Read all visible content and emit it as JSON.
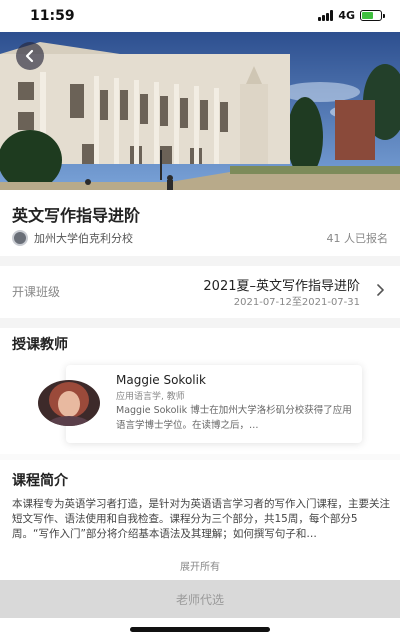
{
  "status_bar": {
    "time": "11:59",
    "network": "4G",
    "battery_level": 0.6,
    "signal_icon": "signal-bars-icon",
    "battery_icon": "battery-icon"
  },
  "hero": {
    "back_icon": "chevron-left-icon"
  },
  "course": {
    "title": "英文写作指导进阶",
    "school": "加州大学伯克利分校",
    "enrolled": "41 人已报名"
  },
  "class_info": {
    "label": "开课班级",
    "name": "2021夏–英文写作指导进阶",
    "dates": "2021-07-12至2021-07-31",
    "arrow_icon": "chevron-right-icon"
  },
  "teacher_section": {
    "title": "授课教师",
    "name": "Maggie Sokolik",
    "role": "应用语言学, 教师",
    "bio": "Maggie Sokolik 博士在加州大学洛杉矶分校获得了应用语言学博士学位。在读博之后，…"
  },
  "intro": {
    "title": "课程简介",
    "text": "本课程专为英语学习者打造，是针对为英语语言学习者的写作入门课程，主要关注短文写作、语法使用和自我检查。课程分为三个部分，共15周，每个部分5周。“写作入门”部分将介绍基本语法及其理解；如何撰写句子和…",
    "expand": "展开所有"
  },
  "bottom": {
    "button": "老师代选"
  },
  "colors": {
    "accent": "#3fbf3f",
    "disabled_button": "#d9d9d9",
    "muted_text": "#888888"
  }
}
